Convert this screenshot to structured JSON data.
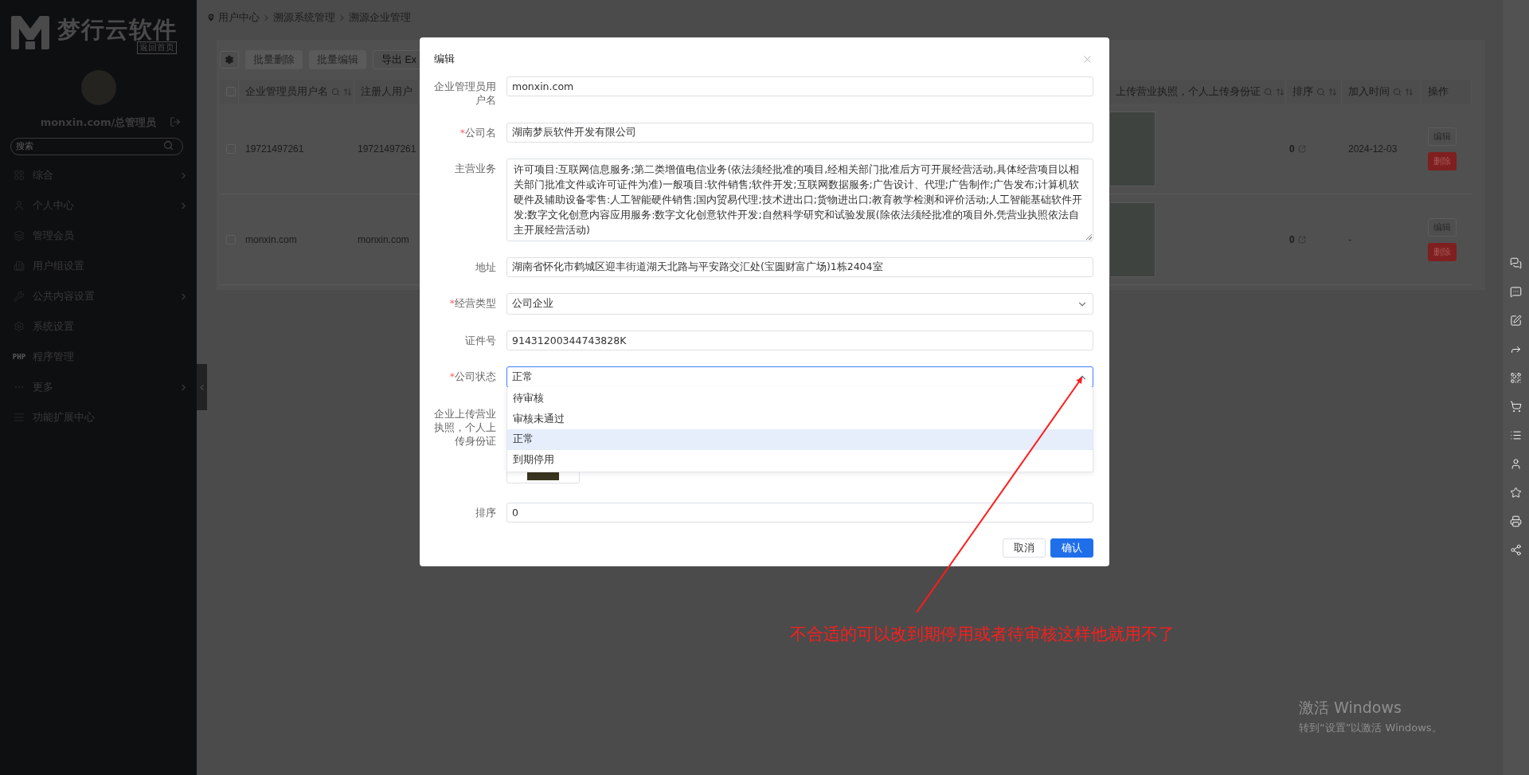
{
  "sidebar": {
    "logo": "梦行云软件",
    "home_link": "返回首页",
    "user": "monxin.com/总管理员",
    "search": {
      "placeholder": "搜索"
    },
    "items": [
      {
        "label": "综合",
        "has_children": true
      },
      {
        "label": "个人中心",
        "has_children": true
      },
      {
        "label": "管理会员",
        "has_children": false
      },
      {
        "label": "用户组设置",
        "has_children": false
      },
      {
        "label": "公共内容设置",
        "has_children": true
      },
      {
        "label": "系统设置",
        "has_children": false
      },
      {
        "label": "程序管理",
        "icon_text": "PHP",
        "has_children": false
      },
      {
        "label": "更多",
        "has_children": true
      },
      {
        "label": "功能扩展中心",
        "has_children": false
      }
    ]
  },
  "breadcrumb": [
    "用户中心",
    "溯源系统管理",
    "溯源企业管理"
  ],
  "toolbar": {
    "buttons": [
      {
        "label": "批量删除",
        "disabled": true
      },
      {
        "label": "批量编辑",
        "disabled": true
      },
      {
        "label": "导出 Ex",
        "disabled": false
      }
    ]
  },
  "table": {
    "select_all": {
      "checked": false
    },
    "columns_left": [
      "企业管理员用户名",
      "注册人用户"
    ],
    "columns_right": [
      "上传营业执照，个人上传身份证",
      "排序",
      "加入时间",
      "操作"
    ],
    "rows": [
      {
        "checked": false,
        "admin": "19721497261",
        "registrant": "19721497261",
        "sort": "0",
        "joined": "2024-12-03",
        "actions": [
          "编辑",
          "删除"
        ]
      },
      {
        "checked": false,
        "admin": "monxin.com",
        "registrant": "monxin.com",
        "sort": "0",
        "joined": "-",
        "actions": [
          "编辑",
          "删除"
        ]
      }
    ]
  },
  "modal": {
    "title": "编辑",
    "fields": [
      {
        "kind": "text",
        "label": "企业管理员用户名",
        "value": "monxin.com"
      },
      {
        "kind": "text",
        "label": "公司名",
        "required_mark": "*",
        "value": "湖南梦辰软件开发有限公司"
      },
      {
        "kind": "textarea",
        "label": "主营业务",
        "value": "许可项目:互联网信息服务;第二类增值电信业务(依法须经批准的项目,经相关部门批准后方可开展经营活动,具体经营项目以相关部门批准文件或许可证件为准)一般项目:软件销售;软件开发;互联网数据服务;广告设计、代理;广告制作;广告发布;计算机软硬件及辅助设备零售:人工智能硬件销售;国内贸易代理;技术进出口;货物进出口;教育教学检测和评价活动;人工智能基础软件开发;数字文化创意内容应用服务:数字文化创意软件开发;自然科学研究和试验发展(除依法须经批准的项目外,凭营业执照依法自主开展经营活动)"
      },
      {
        "kind": "text",
        "label": "地址",
        "value": "湖南省怀化市鹤城区迎丰街道湖天北路与平安路交汇处(宝圆财富广场)1栋2404室"
      },
      {
        "kind": "select",
        "label": "经营类型",
        "required_mark": "*",
        "value": "公司企业",
        "expanded": false
      },
      {
        "kind": "text",
        "label": "证件号",
        "value": "91431200344743828K"
      },
      {
        "kind": "select",
        "label": "公司状态",
        "required_mark": "*",
        "value": "正常",
        "expanded": true,
        "options": [
          {
            "label": "待审核",
            "selected": false
          },
          {
            "label": "审核未通过",
            "selected": false
          },
          {
            "label": "正常",
            "selected": true
          },
          {
            "label": "到期停用",
            "selected": false
          }
        ]
      },
      {
        "kind": "upload",
        "label": "企业上传营业执照，个人上传身份证"
      },
      {
        "kind": "text",
        "label": "排序",
        "value": "0"
      }
    ],
    "buttons": [
      {
        "label": "取消",
        "kind": "secondary"
      },
      {
        "label": "确认",
        "kind": "primary"
      }
    ]
  },
  "annotation": {
    "text": "不合适的可以改到期停用或者待审核这样他就用不了"
  },
  "os_notice": {
    "title": "激活 Windows",
    "subtitle": "转到“设置”以激活 Windows。"
  }
}
